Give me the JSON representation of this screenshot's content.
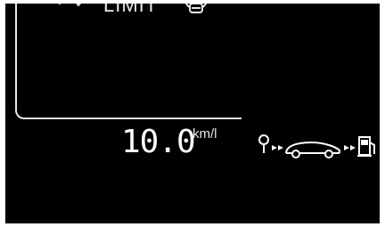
{
  "display": {
    "limit_label": "LIMIT",
    "consumption_value": "10.0",
    "consumption_unit": "km/l"
  },
  "icons": {
    "top_left": [
      "chevron-icon",
      "check-icon"
    ],
    "top_right": "car-lamp-icon",
    "energy_flow": [
      "engine-icon",
      "arrow-icon",
      "car-icon",
      "arrow-icon",
      "fuel-pump-icon"
    ]
  },
  "colors": {
    "background": "#000000",
    "foreground": "#ffffff"
  }
}
